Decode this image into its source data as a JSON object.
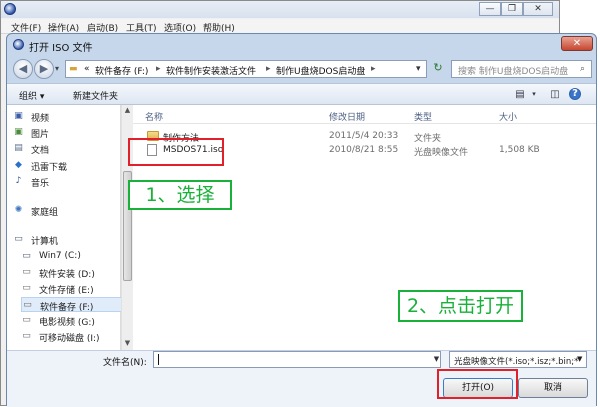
{
  "background_app": {
    "menu": [
      "文件(F)",
      "操作(A)",
      "启动(B)",
      "工具(T)",
      "选项(O)",
      "帮助(H)"
    ],
    "controls": {
      "minimize": "—",
      "restore": "❐",
      "close": "✕"
    }
  },
  "dialog": {
    "title": "打开 ISO 文件",
    "close_glyph": "✕",
    "nav": {
      "back": "◀",
      "forward": "▶",
      "dropdown": "▾"
    },
    "address": {
      "prefix": "«",
      "crumbs": [
        "软件备存 (F:)",
        "软件制作安装激活文件",
        "制作U盘烧DOS启动盘"
      ],
      "separator": "▸",
      "dropdown": "▾"
    },
    "refresh_glyph": "↻",
    "search_placeholder": "搜索 制作U盘烧DOS启动盘",
    "toolbar": {
      "organize": "组织 ▾",
      "new_folder": "新建文件夹"
    },
    "sidebar": [
      {
        "label": "视频",
        "icon": "video-icon",
        "glyph": "▣",
        "color": "#3b5ea8"
      },
      {
        "label": "图片",
        "icon": "picture-icon",
        "glyph": "▣",
        "color": "#4a8b3c"
      },
      {
        "label": "文档",
        "icon": "document-icon",
        "glyph": "▤",
        "color": "#5a6f8f"
      },
      {
        "label": "迅雷下载",
        "icon": "download-icon",
        "glyph": "◆",
        "color": "#2a72c9"
      },
      {
        "label": "音乐",
        "icon": "music-icon",
        "glyph": "♪",
        "color": "#2d4f9c"
      },
      {
        "label": "家庭组",
        "icon": "homegroup-icon",
        "glyph": "✺",
        "color": "#3f76c0"
      },
      {
        "label": "计算机",
        "icon": "computer-icon",
        "glyph": "▭",
        "color": "#4a5a73"
      },
      {
        "label": "Win7 (C:)",
        "icon": "system-drive-icon",
        "glyph": "▭",
        "color": "#4a5a73"
      },
      {
        "label": "软件安装 (D:)",
        "icon": "drive-icon",
        "glyph": "▭",
        "color": "#6a6a6a"
      },
      {
        "label": "文件存储 (E:)",
        "icon": "drive-icon",
        "glyph": "▭",
        "color": "#6a6a6a"
      },
      {
        "label": "软件备存 (F:)",
        "icon": "drive-icon",
        "glyph": "▭",
        "color": "#6a6a6a"
      },
      {
        "label": "电影视频 (G:)",
        "icon": "drive-icon",
        "glyph": "▭",
        "color": "#6a6a6a"
      },
      {
        "label": "可移动磁盘 (I:)",
        "icon": "removable-drive-icon",
        "glyph": "▭",
        "color": "#6a6a6a"
      }
    ],
    "columns": {
      "name": "名称",
      "modified": "修改日期",
      "type": "类型",
      "size": "大小"
    },
    "files": [
      {
        "name": "制作方法",
        "modified": "2011/5/4 20:33",
        "type": "文件夹",
        "size": ""
      },
      {
        "name": "MSDOS71.iso",
        "modified": "2010/8/21 8:55",
        "type": "光盘映像文件",
        "size": "1,508 KB"
      }
    ],
    "filename_label": "文件名(N):",
    "filename_value": "",
    "filetype_value": "光盘映像文件(*.iso;*.isz;*.bin;*",
    "open_button": "打开(O)",
    "cancel_button": "取消"
  },
  "annotations": {
    "step1": "1、选择",
    "step2": "2、点击打开"
  },
  "colors": {
    "annotation_green": "#19b13a",
    "highlight_red": "#e0202a"
  }
}
